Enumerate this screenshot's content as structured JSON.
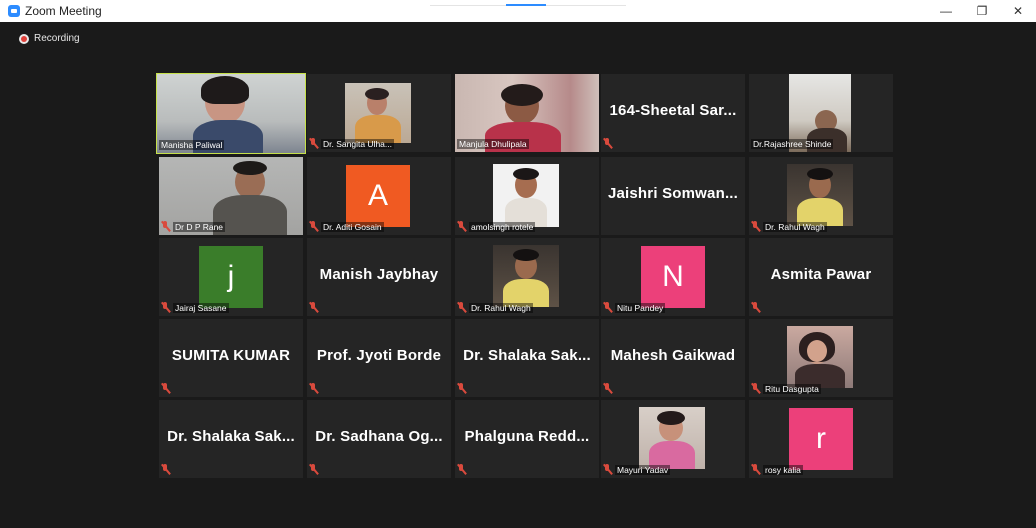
{
  "window": {
    "title": "Zoom Meeting",
    "minimize": "—",
    "restore": "❐",
    "close": "✕"
  },
  "recording": {
    "label": "Recording"
  },
  "tiles": [
    {
      "name": "Manisha Paliwal"
    },
    {
      "name": "Dr. Sangita Ulha..."
    },
    {
      "name": "Manjula Dhulipala"
    },
    {
      "name": "164-Sheetal Sar..."
    },
    {
      "name": "Dr.Rajashree Shinde"
    },
    {
      "name": "Dr D P Rane"
    },
    {
      "name": "Dr. Aditi Gosain",
      "initial": "A"
    },
    {
      "name": "amolsingh rotele"
    },
    {
      "name": "Jaishri Somwan..."
    },
    {
      "name": "Dr. Rahul Wagh"
    },
    {
      "name": "Jairaj Sasane",
      "initial": "j"
    },
    {
      "name": "Manish Jaybhay"
    },
    {
      "name": "Dr. Rahul Wagh"
    },
    {
      "name": "Nitu Pandey",
      "initial": "N"
    },
    {
      "name": "Asmita Pawar"
    },
    {
      "name": "SUMITA KUMAR"
    },
    {
      "name": "Prof. Jyoti Borde"
    },
    {
      "name": "Dr. Shalaka Sak..."
    },
    {
      "name": "Mahesh Gaikwad"
    },
    {
      "name": "Ritu Dasgupta"
    },
    {
      "name": "Dr. Shalaka Sak..."
    },
    {
      "name": "Dr. Sadhana Og..."
    },
    {
      "name": "Phalguna Redd..."
    },
    {
      "name": "Mayuri Yadav"
    },
    {
      "name": "rosy kalia",
      "initial": "r"
    }
  ],
  "colors": {
    "accent": "#2d8cff",
    "active_speaker": "#c6e14a",
    "muted_mic": "#d94a3d",
    "avatar_A": "#f05a22",
    "avatar_j": "#3a7d2a",
    "avatar_N": "#ec407a",
    "avatar_r": "#ec407a"
  }
}
